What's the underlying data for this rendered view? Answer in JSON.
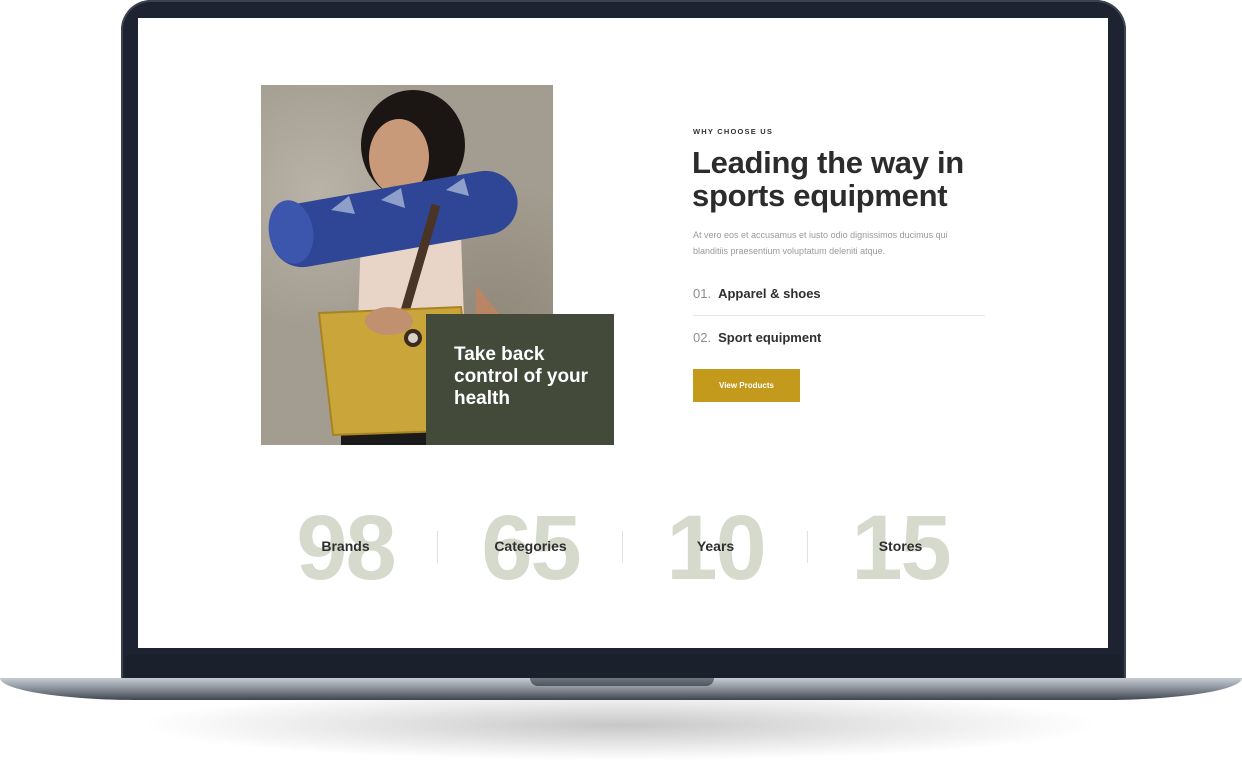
{
  "promo": {
    "text": "Take back control of your health"
  },
  "section": {
    "eyebrow": "WHY CHOOSE US",
    "headline": "Leading the way in sports equipment",
    "lead": "At vero eos et accusamus et iusto odio dignissimos ducimus qui blanditiis praesentium voluptatum deleniti atque."
  },
  "features": [
    {
      "num": "01.",
      "label": "Apparel & shoes"
    },
    {
      "num": "02.",
      "label": "Sport equipment"
    }
  ],
  "cta": {
    "label": "View Products",
    "color": "#c49a1d"
  },
  "stats": [
    {
      "value": "98",
      "label": "Brands"
    },
    {
      "value": "65",
      "label": "Categories"
    },
    {
      "value": "10",
      "label": "Years"
    },
    {
      "value": "15",
      "label": "Stores"
    }
  ],
  "colors": {
    "promo_bg": "#434a3a",
    "stat_number": "#d6dacd",
    "laptop_frame": "#1d2330"
  }
}
